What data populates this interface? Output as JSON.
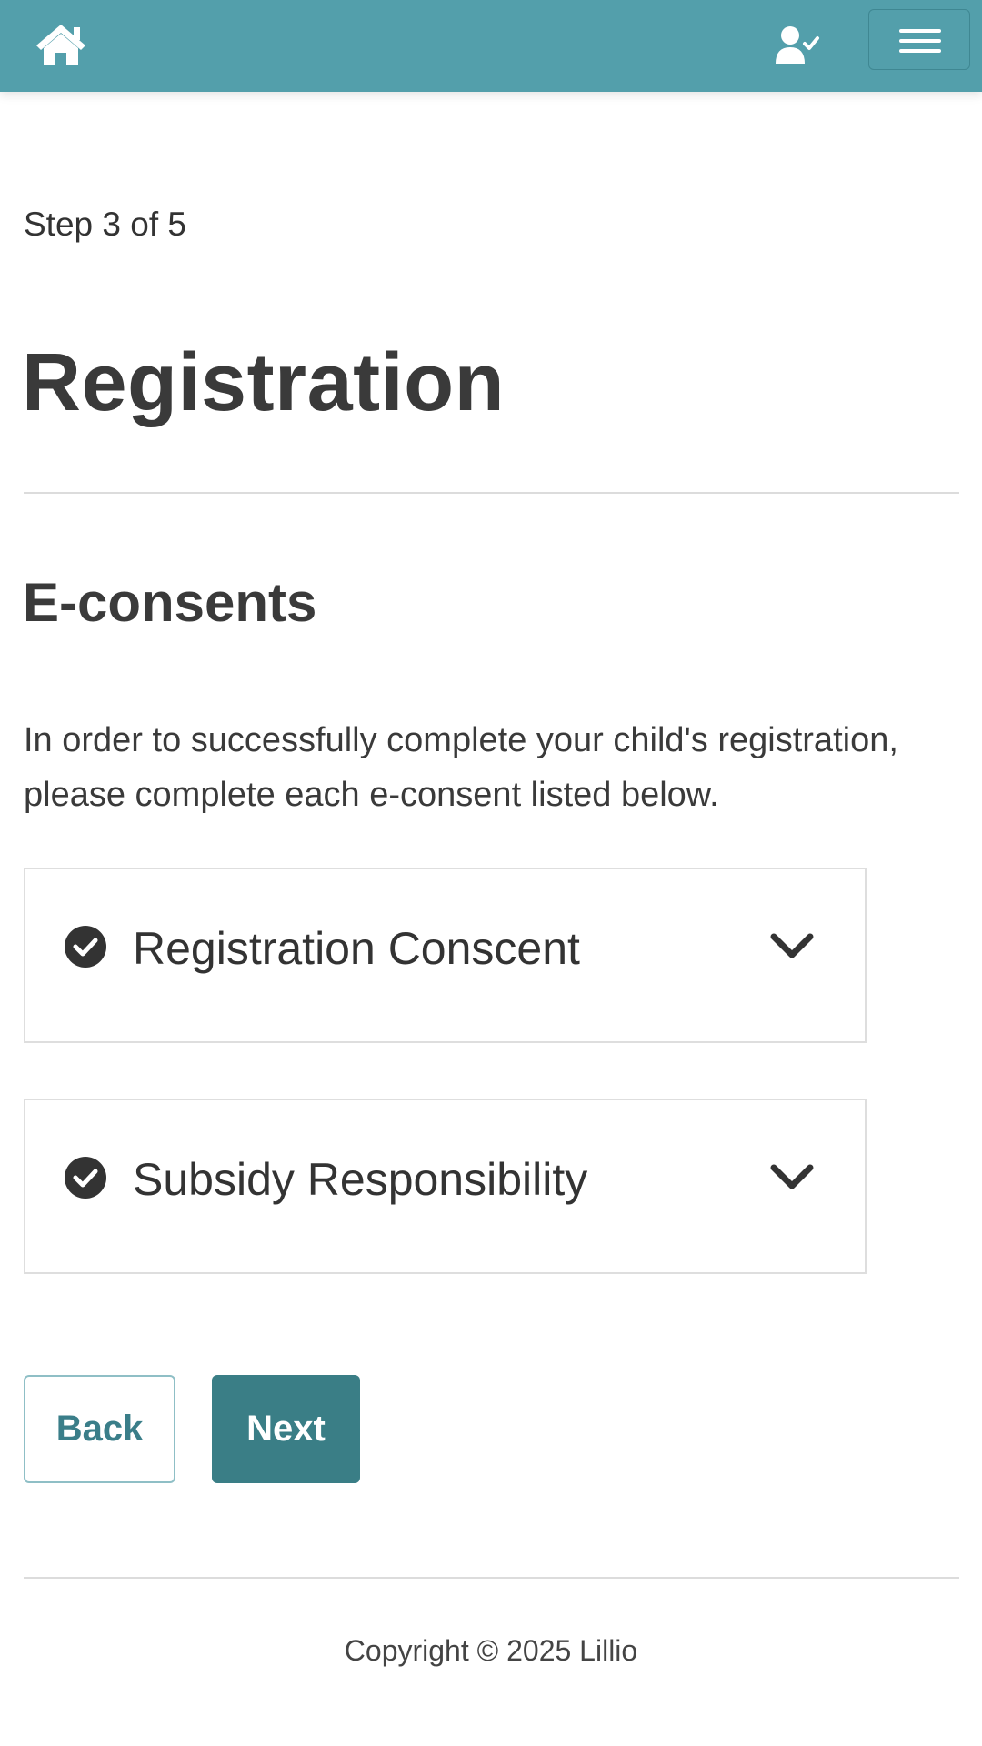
{
  "header": {
    "background_color": "#539fab",
    "home_icon": "home-icon",
    "user_icon": "user-check-icon",
    "menu_icon": "hamburger-menu-icon"
  },
  "main": {
    "step": "Step 3 of 5",
    "title": "Registration",
    "section_title": "E-consents",
    "intro": "In order to successfully complete your child's registration, please complete each e-consent listed below.",
    "consents": [
      {
        "label": "Registration Conscent",
        "status_icon": "check-circle-icon",
        "expand_icon": "chevron-down-icon"
      },
      {
        "label": "Subsidy Responsibility",
        "status_icon": "check-circle-icon",
        "expand_icon": "chevron-down-icon"
      }
    ]
  },
  "actions": {
    "back_label": "Back",
    "next_label": "Next",
    "primary_color": "#3a7e86"
  },
  "footer": {
    "copyright": "Copyright © 2025 Lillio"
  }
}
